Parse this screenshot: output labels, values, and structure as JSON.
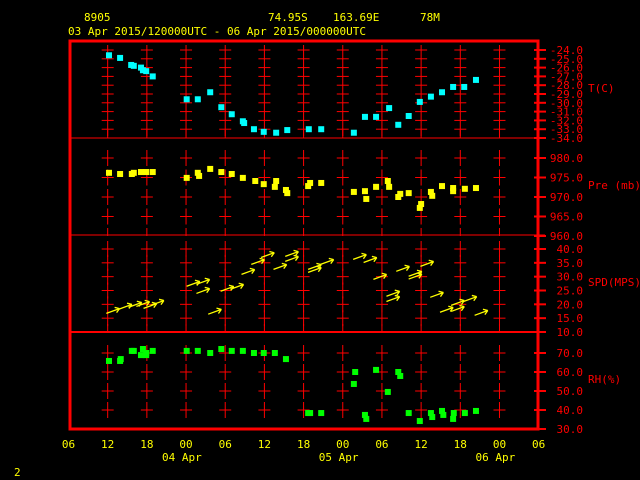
{
  "header": {
    "station": "8905",
    "latitude": "74.95S",
    "longitude": "163.69E",
    "elevation": "78M",
    "period": "03 Apr 2015/120000UTC - 06 Apr 2015/000000UTC"
  },
  "page_number": "2",
  "colors": {
    "frame": "#ff0000",
    "text": "#ffff00",
    "temperature": "#00ffff",
    "pressure": "#ffff00",
    "wind": "#ffff00",
    "humidity": "#00ff00"
  },
  "chart_data": {
    "type": "scatter",
    "title": "8905 74.95S 163.69E 78M",
    "subtitle": "03 Apr 2015/120000UTC - 06 Apr 2015/000000UTC",
    "x_unit": "hours since 03 Apr 2015 06UTC",
    "xlim": [
      0,
      72
    ],
    "x_ticks": [
      {
        "h": 0,
        "label": "06"
      },
      {
        "h": 6,
        "label": "12"
      },
      {
        "h": 12,
        "label": "18"
      },
      {
        "h": 18,
        "label": "00"
      },
      {
        "h": 24,
        "label": "06"
      },
      {
        "h": 30,
        "label": "12"
      },
      {
        "h": 36,
        "label": "18"
      },
      {
        "h": 42,
        "label": "00"
      },
      {
        "h": 48,
        "label": "06"
      },
      {
        "h": 54,
        "label": "12"
      },
      {
        "h": 60,
        "label": "18"
      },
      {
        "h": 66,
        "label": "00"
      },
      {
        "h": 72,
        "label": "06"
      }
    ],
    "date_labels": [
      {
        "h": 18,
        "label": "04 Apr"
      },
      {
        "h": 42,
        "label": "05 Apr"
      },
      {
        "h": 66,
        "label": "06 Apr"
      }
    ],
    "panels": [
      {
        "id": "temperature",
        "label": "T(C)",
        "ylim": [
          -34,
          -24
        ],
        "style": "square",
        "ticks": [
          "-24.0",
          "-25.0",
          "-26.0",
          "-27.0",
          "-28.0",
          "-29.0",
          "-30.0",
          "-31.0",
          "-32.0",
          "-33.0",
          "-34.0"
        ],
        "tick_values": [
          -24,
          -25,
          -26,
          -27,
          -28,
          -29,
          -30,
          -31,
          -32,
          -33,
          -34
        ],
        "points": [
          [
            6.2,
            -24.6
          ],
          [
            7.9,
            -24.9
          ],
          [
            9.6,
            -25.7
          ],
          [
            10.0,
            -25.8
          ],
          [
            11.1,
            -26.0
          ],
          [
            11.4,
            -26.3
          ],
          [
            11.9,
            -26.4
          ],
          [
            12.9,
            -27.0
          ],
          [
            18.1,
            -29.6
          ],
          [
            19.8,
            -29.6
          ],
          [
            21.7,
            -28.8
          ],
          [
            23.4,
            -30.5
          ],
          [
            25.0,
            -31.3
          ],
          [
            26.7,
            -32.1
          ],
          [
            26.9,
            -32.3
          ],
          [
            28.4,
            -33.0
          ],
          [
            29.9,
            -33.3
          ],
          [
            31.8,
            -33.4
          ],
          [
            33.5,
            -33.1
          ],
          [
            36.8,
            -33.0
          ],
          [
            38.7,
            -33.0
          ],
          [
            43.7,
            -33.4
          ],
          [
            45.4,
            -31.6
          ],
          [
            47.1,
            -31.6
          ],
          [
            49.1,
            -30.6
          ],
          [
            50.5,
            -32.5
          ],
          [
            52.1,
            -31.5
          ],
          [
            53.8,
            -29.9
          ],
          [
            55.5,
            -29.3
          ],
          [
            57.2,
            -28.8
          ],
          [
            58.9,
            -28.2
          ],
          [
            60.6,
            -28.2
          ],
          [
            62.4,
            -27.4
          ]
        ]
      },
      {
        "id": "pressure",
        "label": "Pre (mb)",
        "ylim": [
          960,
          980
        ],
        "style": "square",
        "ticks": [
          "980.0",
          "975.0",
          "970.0",
          "965.0",
          "960.0"
        ],
        "tick_values": [
          980,
          975,
          970,
          965,
          960
        ],
        "points": [
          [
            6.2,
            976.2
          ],
          [
            7.9,
            975.9
          ],
          [
            9.7,
            975.9
          ],
          [
            10.0,
            976.2
          ],
          [
            11.1,
            976.4
          ],
          [
            11.9,
            976.4
          ],
          [
            12.9,
            976.4
          ],
          [
            18.1,
            974.9
          ],
          [
            19.8,
            976.2
          ],
          [
            20.0,
            975.4
          ],
          [
            21.7,
            977.2
          ],
          [
            23.4,
            976.4
          ],
          [
            25.0,
            975.9
          ],
          [
            26.7,
            974.9
          ],
          [
            28.6,
            974.1
          ],
          [
            29.9,
            973.3
          ],
          [
            31.6,
            972.6
          ],
          [
            31.8,
            974.1
          ],
          [
            33.3,
            971.8
          ],
          [
            33.5,
            971.0
          ],
          [
            36.7,
            972.8
          ],
          [
            37.0,
            973.6
          ],
          [
            38.7,
            973.6
          ],
          [
            43.7,
            971.3
          ],
          [
            45.4,
            971.5
          ],
          [
            45.6,
            969.5
          ],
          [
            47.1,
            972.6
          ],
          [
            48.9,
            974.1
          ],
          [
            49.1,
            972.6
          ],
          [
            50.5,
            970.0
          ],
          [
            50.8,
            970.8
          ],
          [
            52.1,
            971.0
          ],
          [
            53.8,
            967.2
          ],
          [
            54.0,
            968.2
          ],
          [
            55.5,
            971.3
          ],
          [
            55.7,
            970.3
          ],
          [
            57.2,
            972.8
          ],
          [
            58.9,
            972.3
          ],
          [
            58.9,
            971.5
          ],
          [
            60.7,
            972.1
          ],
          [
            62.4,
            972.3
          ]
        ]
      },
      {
        "id": "wind",
        "label": "SPD(MPS)",
        "ylim": [
          10,
          40
        ],
        "style": "arrow",
        "wind_from_deg": 250,
        "ticks": [
          "40.0",
          "35.0",
          "30.0",
          "25.0",
          "20.0",
          "15.0",
          "10.0"
        ],
        "tick_values": [
          40,
          35,
          30,
          25,
          20,
          15,
          10
        ],
        "points": [
          [
            6.8,
            17.6
          ],
          [
            8.7,
            19.1
          ],
          [
            10.2,
            19.8
          ],
          [
            11.4,
            20.1
          ],
          [
            12.5,
            19.4
          ],
          [
            13.6,
            20.5
          ],
          [
            19.1,
            27.4
          ],
          [
            20.6,
            28.1
          ],
          [
            20.6,
            24.8
          ],
          [
            22.4,
            17.3
          ],
          [
            24.3,
            25.6
          ],
          [
            25.8,
            26.3
          ],
          [
            27.5,
            31.7
          ],
          [
            29.0,
            35.3
          ],
          [
            30.5,
            37.8
          ],
          [
            32.4,
            33.5
          ],
          [
            34.2,
            38.2
          ],
          [
            34.2,
            36.4
          ],
          [
            37.7,
            32.4
          ],
          [
            37.7,
            33.5
          ],
          [
            39.6,
            35.3
          ],
          [
            44.6,
            37.1
          ],
          [
            46.2,
            36.0
          ],
          [
            47.7,
            29.9
          ],
          [
            49.7,
            23.8
          ],
          [
            49.7,
            21.9
          ],
          [
            51.2,
            32.8
          ],
          [
            53.1,
            31.0
          ],
          [
            53.1,
            30.0
          ],
          [
            54.9,
            34.6
          ],
          [
            56.4,
            23.4
          ],
          [
            57.9,
            18.0
          ],
          [
            59.6,
            20.5
          ],
          [
            59.6,
            18.3
          ],
          [
            61.5,
            21.9
          ],
          [
            63.2,
            16.9
          ]
        ]
      },
      {
        "id": "humidity",
        "label": "RH(%)",
        "ylim": [
          30,
          70
        ],
        "style": "square",
        "ticks": [
          "70.0",
          "60.0",
          "50.0",
          "40.0",
          "30.0"
        ],
        "tick_values": [
          70,
          60,
          50,
          40,
          30
        ],
        "points": [
          [
            6.2,
            65.8
          ],
          [
            7.9,
            65.8
          ],
          [
            8.0,
            66.8
          ],
          [
            9.7,
            71.1
          ],
          [
            10.0,
            71.1
          ],
          [
            11.1,
            68.9
          ],
          [
            11.4,
            72.1
          ],
          [
            11.9,
            68.9
          ],
          [
            11.9,
            70.0
          ],
          [
            12.9,
            71.1
          ],
          [
            18.1,
            71.1
          ],
          [
            19.8,
            71.1
          ],
          [
            21.7,
            70.0
          ],
          [
            23.4,
            72.1
          ],
          [
            25.0,
            71.1
          ],
          [
            26.7,
            71.1
          ],
          [
            28.4,
            70.0
          ],
          [
            29.9,
            70.0
          ],
          [
            31.6,
            70.0
          ],
          [
            33.3,
            66.8
          ],
          [
            36.7,
            38.4
          ],
          [
            37.0,
            38.4
          ],
          [
            38.7,
            38.4
          ],
          [
            43.7,
            53.7
          ],
          [
            43.9,
            60.0
          ],
          [
            45.4,
            37.4
          ],
          [
            45.6,
            35.3
          ],
          [
            47.1,
            61.1
          ],
          [
            48.9,
            49.5
          ],
          [
            50.5,
            60.0
          ],
          [
            50.8,
            57.9
          ],
          [
            52.1,
            38.4
          ],
          [
            53.8,
            34.2
          ],
          [
            55.5,
            38.4
          ],
          [
            55.7,
            36.3
          ],
          [
            57.2,
            39.5
          ],
          [
            57.4,
            37.4
          ],
          [
            58.9,
            35.3
          ],
          [
            59.0,
            38.4
          ],
          [
            60.7,
            38.4
          ],
          [
            62.4,
            39.5
          ]
        ]
      }
    ]
  }
}
